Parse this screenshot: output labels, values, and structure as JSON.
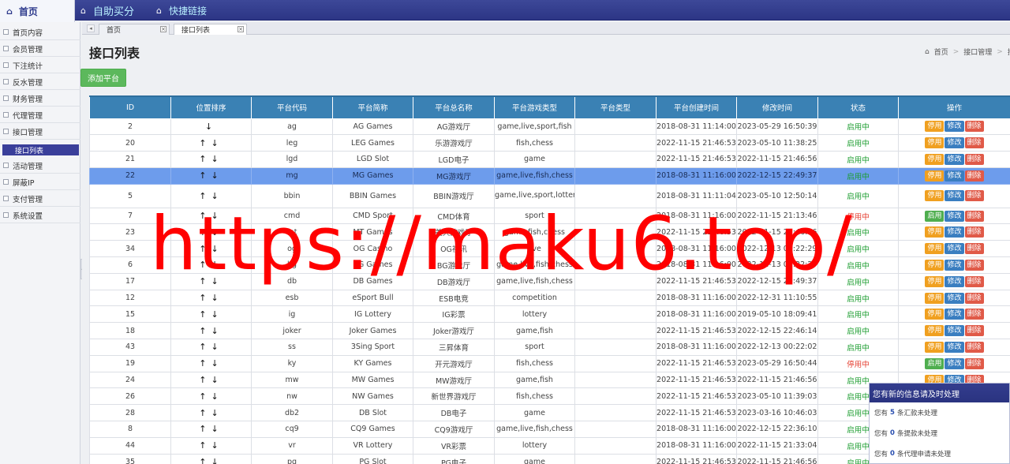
{
  "topbar": {
    "home_label": "首页",
    "nav1": "自助买分",
    "nav2": "快捷链接"
  },
  "sidebar": {
    "items": [
      "首页内容",
      "会员管理",
      "下注统计",
      "反水管理",
      "财务管理",
      "代理管理",
      "接口管理",
      "接口列表",
      "活动管理",
      "屏蔽IP",
      "支付管理",
      "系统设置"
    ],
    "active_index": 7
  },
  "tabs": [
    {
      "label": "首页",
      "active": false
    },
    {
      "label": "接口列表",
      "active": true
    }
  ],
  "page": {
    "title": "接口列表",
    "breadcrumb": [
      "首页",
      "接口管理",
      "接口"
    ],
    "add_button": "添加平台"
  },
  "table": {
    "headers": [
      "ID",
      "位置排序",
      "平台代码",
      "平台简称",
      "平台总名称",
      "平台游戏类型",
      "平台类型",
      "平台创建时间",
      "修改时间",
      "状态",
      "操作"
    ],
    "op_labels": {
      "stop": "停用",
      "start": "启用",
      "edit": "修改",
      "del": "删除"
    },
    "rows": [
      {
        "id": "2",
        "arrows": "↓",
        "code": "ag",
        "short": "AG Games",
        "name": "AG游戏厅",
        "types": "game,live,sport,fish",
        "ptype": "",
        "created": "2018-08-31 11:14:00",
        "modified": "2023-05-29 16:50:39",
        "status": "启用中",
        "on": true
      },
      {
        "id": "20",
        "arrows": "↑↓",
        "code": "leg",
        "short": "LEG Games",
        "name": "乐游游戏厅",
        "types": "fish,chess",
        "ptype": "",
        "created": "2022-11-15 21:46:53",
        "modified": "2023-05-10 11:38:25",
        "status": "启用中",
        "on": true
      },
      {
        "id": "21",
        "arrows": "↑↓",
        "code": "lgd",
        "short": "LGD Slot",
        "name": "LGD电子",
        "types": "game",
        "ptype": "",
        "created": "2022-11-15 21:46:53",
        "modified": "2022-11-15 21:46:56",
        "status": "启用中",
        "on": true
      },
      {
        "id": "22",
        "arrows": "↑↓",
        "code": "mg",
        "short": "MG Games",
        "name": "MG游戏厅",
        "types": "game,live,fish,chess",
        "ptype": "",
        "created": "2018-08-31 11:16:00",
        "modified": "2022-12-15 22:49:37",
        "status": "启用中",
        "on": true,
        "hl": true
      },
      {
        "id": "5",
        "arrows": "↑↓",
        "code": "bbin",
        "short": "BBIN Games",
        "name": "BBIN游戏厅",
        "types": "game,live,sport,lottery,fish,chess",
        "ptype": "",
        "created": "2018-08-31 11:11:04",
        "modified": "2023-05-10 12:50:14",
        "status": "启用中",
        "on": true,
        "tall": true
      },
      {
        "id": "7",
        "arrows": "↑↓",
        "code": "cmd",
        "short": "CMD Sport",
        "name": "CMD体育",
        "types": "sport",
        "ptype": "",
        "created": "2018-08-31 11:16:00",
        "modified": "2022-11-15 21:13:46",
        "status": "停用中",
        "on": false
      },
      {
        "id": "23",
        "arrows": "↑↓",
        "code": "mt",
        "short": "MT Games",
        "name": "美天游戏厅",
        "types": "game,fish,chess",
        "ptype": "",
        "created": "2022-11-15 21:46:53",
        "modified": "2022-11-15 21:46:56",
        "status": "启用中",
        "on": true
      },
      {
        "id": "34",
        "arrows": "↑↓",
        "code": "og",
        "short": "OG Casino",
        "name": "OG视讯",
        "types": "live",
        "ptype": "",
        "created": "2018-08-31 11:16:00",
        "modified": "2022-12-13 00:22:29",
        "status": "启用中",
        "on": true
      },
      {
        "id": "6",
        "arrows": "↑↓",
        "code": "bg",
        "short": "BG Games",
        "name": "BG游戏厅",
        "types": "game,live,fish,chess",
        "ptype": "",
        "created": "2018-08-31 11:16:00",
        "modified": "2022-12-13 00:22:29",
        "status": "启用中",
        "on": true
      },
      {
        "id": "17",
        "arrows": "↑↓",
        "code": "db",
        "short": "DB Games",
        "name": "DB游戏厅",
        "types": "game,live,fish,chess",
        "ptype": "",
        "created": "2022-11-15 21:46:53",
        "modified": "2022-12-15 22:49:37",
        "status": "启用中",
        "on": true
      },
      {
        "id": "12",
        "arrows": "↑↓",
        "code": "esb",
        "short": "eSport Bull",
        "name": "ESB电竞",
        "types": "competition",
        "ptype": "",
        "created": "2018-08-31 11:16:00",
        "modified": "2022-12-31 11:10:55",
        "status": "启用中",
        "on": true
      },
      {
        "id": "15",
        "arrows": "↑↓",
        "code": "ig",
        "short": "IG Lottery",
        "name": "IG彩票",
        "types": "lottery",
        "ptype": "",
        "created": "2018-08-31 11:16:00",
        "modified": "2019-05-10 18:09:41",
        "status": "启用中",
        "on": true
      },
      {
        "id": "18",
        "arrows": "↑↓",
        "code": "joker",
        "short": "Joker Games",
        "name": "Joker游戏厅",
        "types": "game,fish",
        "ptype": "",
        "created": "2022-11-15 21:46:53",
        "modified": "2022-12-15 22:46:14",
        "status": "启用中",
        "on": true
      },
      {
        "id": "43",
        "arrows": "↑↓",
        "code": "ss",
        "short": "3Sing Sport",
        "name": "三昇体育",
        "types": "sport",
        "ptype": "",
        "created": "2018-08-31 11:16:00",
        "modified": "2022-12-13 00:22:02",
        "status": "启用中",
        "on": true
      },
      {
        "id": "19",
        "arrows": "↑↓",
        "code": "ky",
        "short": "KY Games",
        "name": "开元游戏厅",
        "types": "fish,chess",
        "ptype": "",
        "created": "2022-11-15 21:46:53",
        "modified": "2023-05-29 16:50:44",
        "status": "停用中",
        "on": false
      },
      {
        "id": "24",
        "arrows": "↑↓",
        "code": "mw",
        "short": "MW Games",
        "name": "MW游戏厅",
        "types": "game,fish",
        "ptype": "",
        "created": "2022-11-15 21:46:53",
        "modified": "2022-11-15 21:46:56",
        "status": "启用中",
        "on": true
      },
      {
        "id": "26",
        "arrows": "↑↓",
        "code": "nw",
        "short": "NW Games",
        "name": "新世界游戏厅",
        "types": "fish,chess",
        "ptype": "",
        "created": "2022-11-15 21:46:53",
        "modified": "2023-05-10 11:39:03",
        "status": "启用中",
        "on": true
      },
      {
        "id": "28",
        "arrows": "↑↓",
        "code": "db2",
        "short": "DB Slot",
        "name": "DB电子",
        "types": "game",
        "ptype": "",
        "created": "2022-11-15 21:46:53",
        "modified": "2023-03-16 10:46:03",
        "status": "启用中",
        "on": true
      },
      {
        "id": "8",
        "arrows": "↑↓",
        "code": "cq9",
        "short": "CQ9 Games",
        "name": "CQ9游戏厅",
        "types": "game,live,fish,chess",
        "ptype": "",
        "created": "2018-08-31 11:16:00",
        "modified": "2022-12-15 22:36:10",
        "status": "启用中",
        "on": true
      },
      {
        "id": "44",
        "arrows": "↑↓",
        "code": "vr",
        "short": "VR Lottery",
        "name": "VR彩票",
        "types": "lottery",
        "ptype": "",
        "created": "2018-08-31 11:16:00",
        "modified": "2022-11-15 21:33:04",
        "status": "启用中",
        "on": true
      },
      {
        "id": "35",
        "arrows": "↑↓",
        "code": "pg",
        "short": "PG Slot",
        "name": "PG电子",
        "types": "game",
        "ptype": "",
        "created": "2022-11-15 21:46:53",
        "modified": "2022-11-15 21:46:56",
        "status": "启用中",
        "on": true
      }
    ]
  },
  "notice": {
    "title": "您有新的信息请及时处理",
    "rows": [
      {
        "pre": "您有",
        "count": "5",
        "post": "条汇款未处理"
      },
      {
        "pre": "您有",
        "count": "0",
        "post": "条提款未处理"
      },
      {
        "pre": "您有",
        "count": "0",
        "post": "条代理申请未处理"
      }
    ]
  },
  "watermark": "https://maku6.top/"
}
